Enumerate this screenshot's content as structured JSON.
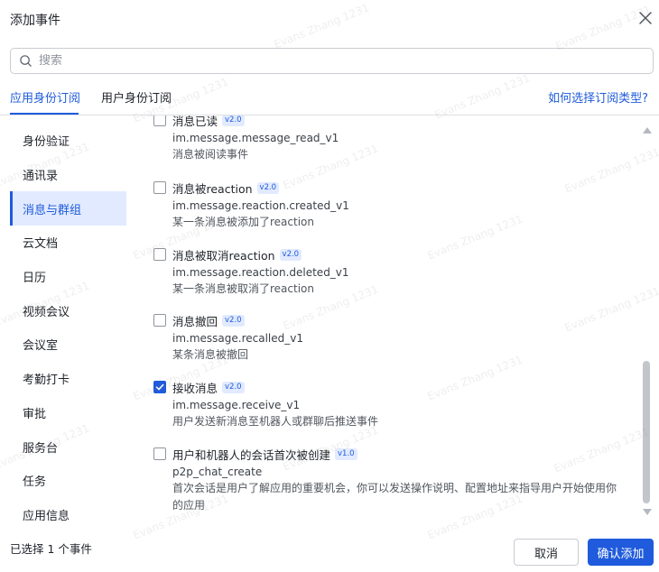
{
  "dialog": {
    "title": "添加事件",
    "close_icon": "close-icon"
  },
  "search": {
    "placeholder": "搜索",
    "value": "",
    "icon": "search-icon"
  },
  "tabs": {
    "items": [
      {
        "label": "应用身份订阅",
        "active": true
      },
      {
        "label": "用户身份订阅",
        "active": false
      }
    ],
    "help_link": "如何选择订阅类型?"
  },
  "sidebar": {
    "items": [
      {
        "label": "身份验证",
        "active": false
      },
      {
        "label": "通讯录",
        "active": false
      },
      {
        "label": "消息与群组",
        "active": true
      },
      {
        "label": "云文档",
        "active": false
      },
      {
        "label": "日历",
        "active": false
      },
      {
        "label": "视频会议",
        "active": false
      },
      {
        "label": "会议室",
        "active": false
      },
      {
        "label": "考勤打卡",
        "active": false
      },
      {
        "label": "审批",
        "active": false
      },
      {
        "label": "服务台",
        "active": false
      },
      {
        "label": "任务",
        "active": false
      },
      {
        "label": "应用信息",
        "active": false
      }
    ]
  },
  "events": [
    {
      "name": "消息已读",
      "version": "v2.0",
      "key": "im.message.message_read_v1",
      "desc": "消息被阅读事件",
      "checked": false
    },
    {
      "name": "消息被reaction",
      "version": "v2.0",
      "key": "im.message.reaction.created_v1",
      "desc": "某一条消息被添加了reaction",
      "checked": false
    },
    {
      "name": "消息被取消reaction",
      "version": "v2.0",
      "key": "im.message.reaction.deleted_v1",
      "desc": "某一条消息被取消了reaction",
      "checked": false
    },
    {
      "name": "消息撤回",
      "version": "v2.0",
      "key": "im.message.recalled_v1",
      "desc": "某条消息被撤回",
      "checked": false
    },
    {
      "name": "接收消息",
      "version": "v2.0",
      "key": "im.message.receive_v1",
      "desc": "用户发送新消息至机器人或群聊后推送事件",
      "checked": true
    },
    {
      "name": "用户和机器人的会话首次被创建",
      "version": "v1.0",
      "key": "p2p_chat_create",
      "desc_lines": [
        "首次会话是用户了解应用的重要机会，你可以发送操作说明、配置地址来指导用户开始使用你",
        "的应用"
      ],
      "checked": false
    }
  ],
  "footer": {
    "selected_text": "已选择 1 个事件",
    "cancel_label": "取消",
    "confirm_label": "确认添加"
  },
  "watermark": "Evans Zhang 1231",
  "colors": {
    "accent": "#1f5bdc",
    "active_bg": "#e1eaff",
    "border": "#c9ccd1"
  }
}
